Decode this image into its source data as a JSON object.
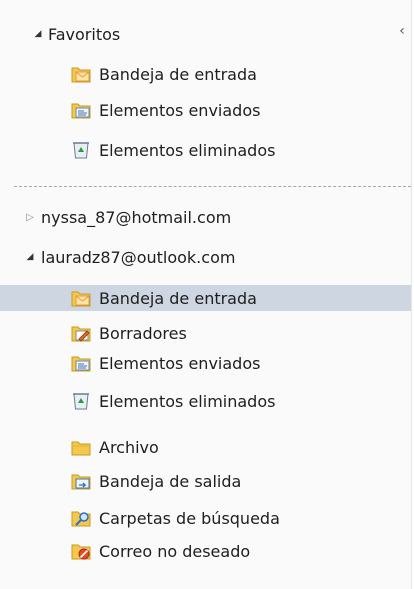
{
  "collapse_glyph": "‹",
  "favorites": {
    "label": "Favoritos",
    "items": [
      {
        "label": "Bandeja de entrada",
        "icon": "inbox-icon"
      },
      {
        "label": "Elementos enviados",
        "icon": "sent-items-icon"
      },
      {
        "label": "Elementos eliminados",
        "icon": "deleted-items-icon"
      }
    ]
  },
  "accounts": [
    {
      "label": "nyssa_87@hotmail.com",
      "expanded": false
    },
    {
      "label": "lauradz87@outlook.com",
      "expanded": true,
      "folders": [
        {
          "label": "Bandeja de entrada",
          "icon": "inbox-icon",
          "selected": true
        },
        {
          "label": "Borradores",
          "icon": "drafts-icon"
        },
        {
          "label": "Elementos enviados",
          "icon": "sent-items-icon"
        },
        {
          "label": "Elementos eliminados",
          "icon": "deleted-items-icon"
        },
        {
          "label": "Archivo",
          "icon": "folder-icon"
        },
        {
          "label": "Bandeja de salida",
          "icon": "outbox-icon"
        },
        {
          "label": "Carpetas de búsqueda",
          "icon": "search-folder-icon"
        },
        {
          "label": "Correo no deseado",
          "icon": "junk-email-icon"
        }
      ]
    }
  ],
  "colors": {
    "selected_background": "#cdd6e1",
    "folder_yellow": "#f3c94d",
    "envelope_orange": "#f0a04a",
    "recycle_green": "#2e9b3a"
  }
}
